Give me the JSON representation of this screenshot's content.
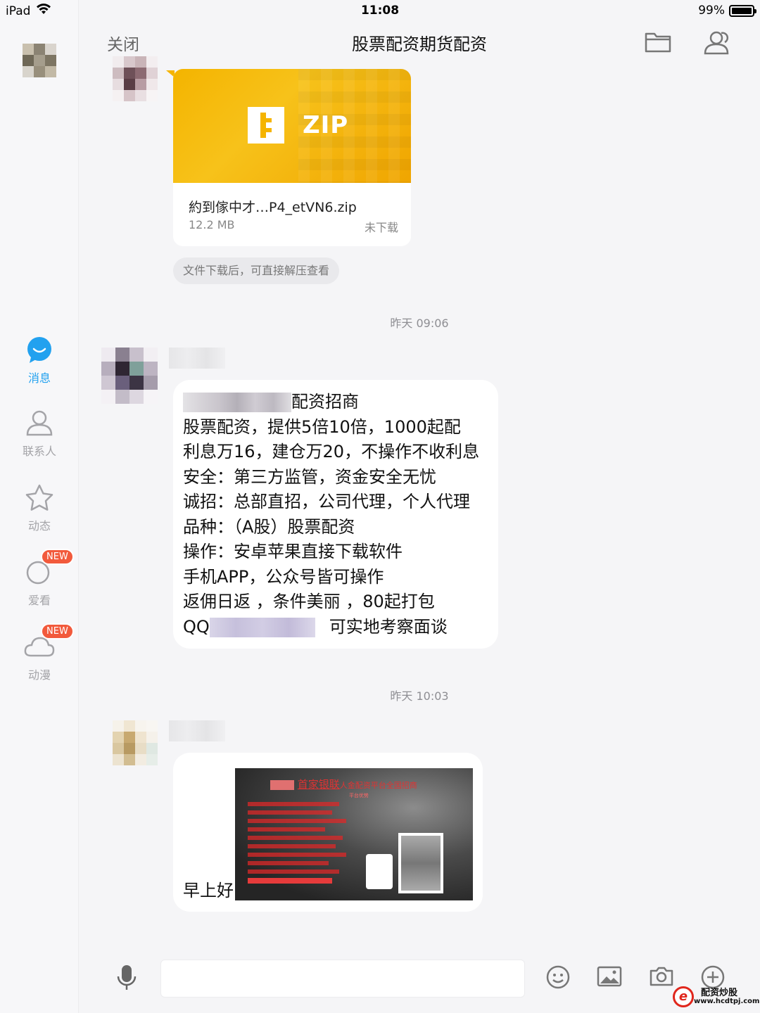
{
  "status_bar": {
    "device": "iPad",
    "time": "11:08",
    "battery": "99%",
    "battery_level": 0.99
  },
  "sidebar": {
    "items": [
      {
        "label": "消息",
        "icon": "chat-bubble-icon",
        "active": true
      },
      {
        "label": "联系人",
        "icon": "contact-icon",
        "active": false
      },
      {
        "label": "动态",
        "icon": "star-icon",
        "active": false
      },
      {
        "label": "爱看",
        "icon": "cloud-icon",
        "badge": "NEW"
      },
      {
        "label": "动漫",
        "icon": "cloud-icon",
        "badge": "NEW"
      }
    ]
  },
  "header": {
    "close_label": "关闭",
    "title": "股票配资期货配资",
    "icons": [
      "folder-icon",
      "group-members-icon"
    ]
  },
  "messages": {
    "file": {
      "badge_text": "ZIP",
      "name": "約到傢中才…P4_etVN6.zip",
      "size": "12.2 MB",
      "status": "未下载",
      "hint": "文件下载后，可直接解压查看"
    },
    "ts1": "昨天 09:06",
    "text_lines": [
      "配资招商",
      "股票配资，提供5倍10倍，1000起配",
      "利息万16，建仓万20，不操作不收利息",
      "安全：第三方监管，资金安全无忧",
      "诚招：总部直招，公司代理，个人代理",
      "品种：（A股）股票配资",
      "操作：安卓苹果直接下载软件",
      "手机APP，公众号皆可操作",
      "返佣日返 ，条件美丽 ，80起打包",
      "QQ",
      "可实地考察面谈"
    ],
    "ts2": "昨天 10:03",
    "image_msg": {
      "greeting": "早上好",
      "image_title": "首家银联",
      "image_title_suffix": "人金配资平台全国招商",
      "image_subtitle": "平台优势"
    }
  },
  "input_bar": {
    "icons": [
      "microphone-icon",
      "emoji-icon",
      "image-icon",
      "camera-icon",
      "plus-icon"
    ]
  },
  "watermark": {
    "line1": "配资炒股",
    "line2": "www.hcdtpj.com"
  },
  "colors": {
    "accent": "#22a1ef",
    "zip_banner": "#f5b400",
    "badge": "#f25a3c",
    "background": "#f5f5f7"
  }
}
